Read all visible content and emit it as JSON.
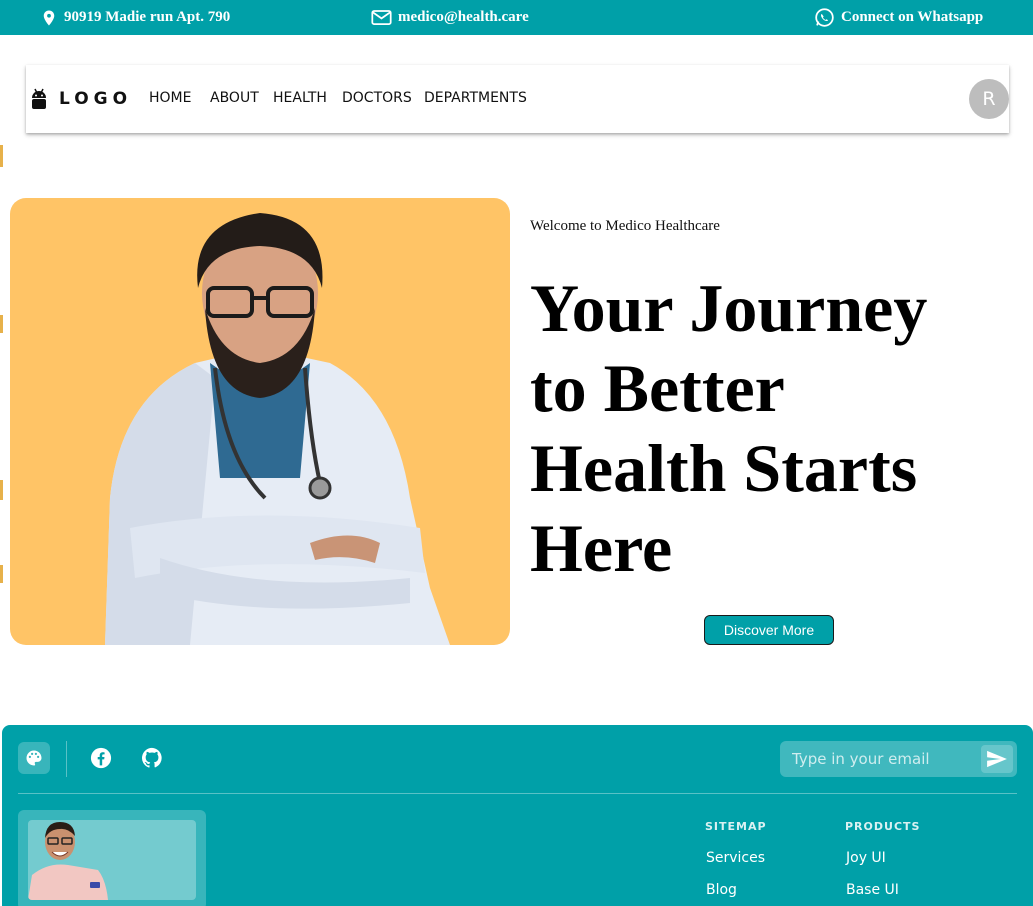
{
  "topbar": {
    "address": "90919 Madie run Apt. 790",
    "email": "medico@health.care",
    "whatsapp": "Connect on Whatsapp"
  },
  "nav": {
    "logo_text": "LOGO",
    "items": [
      "HOME",
      "ABOUT",
      "HEALTH",
      "DOCTORS",
      "DEPARTMENTS"
    ],
    "avatar_initial": "R"
  },
  "hero": {
    "welcome": "Welcome to Medico Healthcare",
    "headline": "Your Journey to Better Health Starts Here",
    "cta": "Discover More"
  },
  "footer": {
    "email_placeholder": "Type in your email",
    "sitemap": {
      "title": "SITEMAP",
      "links": [
        "Services",
        "Blog"
      ]
    },
    "products": {
      "title": "PRODUCTS",
      "links": [
        "Joy UI",
        "Base UI"
      ]
    }
  },
  "colors": {
    "brand": "#00a0a8",
    "hero_bg": "#ffc466"
  },
  "icons": [
    "location-pin-icon",
    "mail-icon",
    "whatsapp-icon",
    "android-logo-icon",
    "palette-icon",
    "facebook-icon",
    "github-icon",
    "send-icon"
  ]
}
